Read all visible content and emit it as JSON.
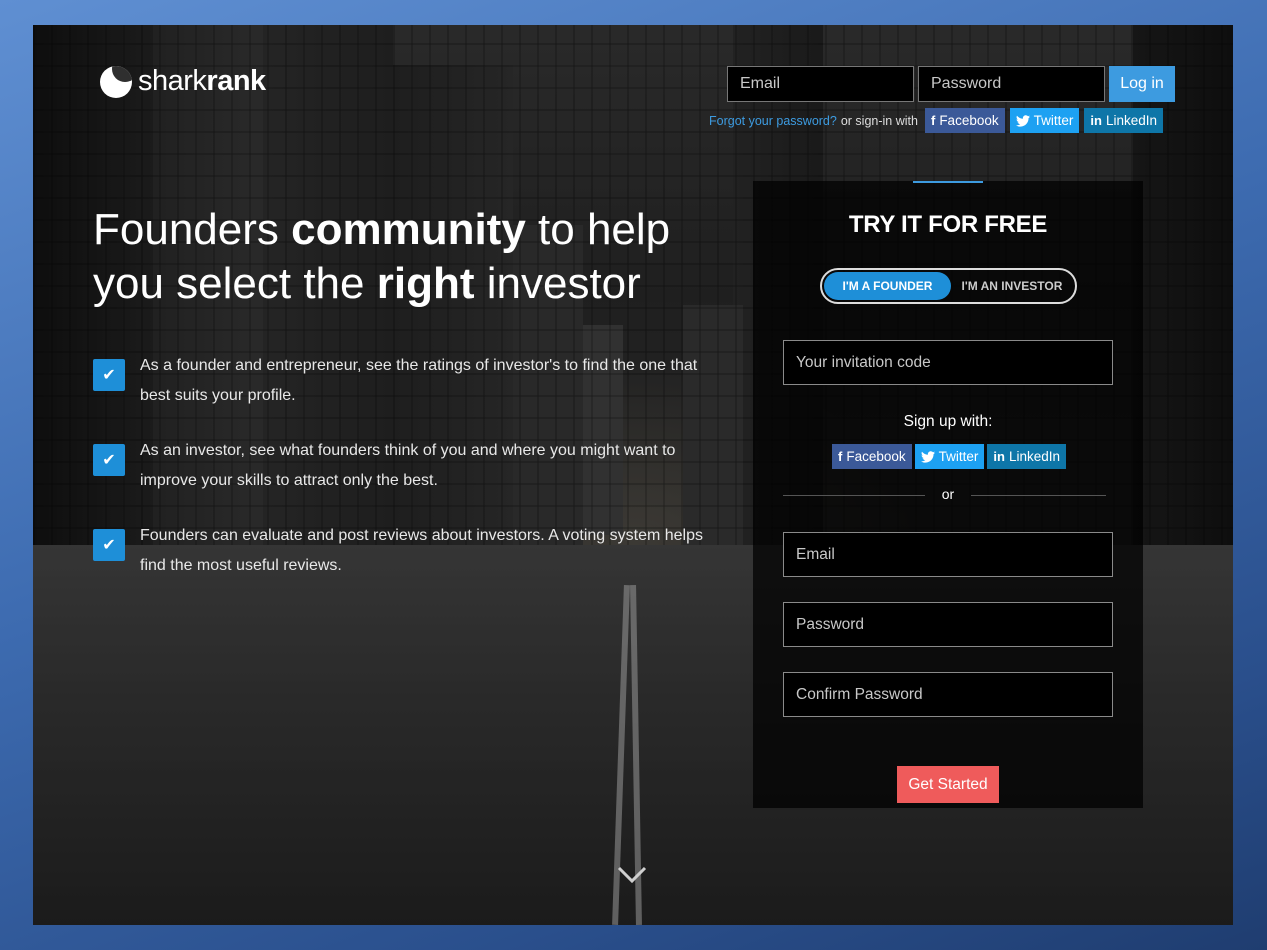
{
  "brand": {
    "name_light": "shark",
    "name_bold": "rank"
  },
  "header": {
    "email_placeholder": "Email",
    "password_placeholder": "Password",
    "login_label": "Log in",
    "forgot_label": "Forgot your password?",
    "signin_with_label": "or sign-in with",
    "social": {
      "facebook": "Facebook",
      "twitter": "Twitter",
      "linkedin": "LinkedIn"
    }
  },
  "hero": {
    "line1_a": "Founders ",
    "line1_bold": "community",
    "line1_b": " to help",
    "line2_a": "you select the ",
    "line2_bold": "right",
    "line2_b": " investor"
  },
  "features": [
    {
      "text": "As a founder and entrepreneur, see the ratings of investor's to find the one that best suits your profile."
    },
    {
      "text": "As an investor, see what founders think of you and where you might want to improve your skills to attract only the best."
    },
    {
      "text": "Founders can evaluate and post reviews about investors. A voting system helps find the most useful reviews."
    }
  ],
  "signup": {
    "title": "TRY IT FOR FREE",
    "role_founder": "I'M A FOUNDER",
    "role_investor": "I'M AN INVESTOR",
    "invitation_placeholder": "Your invitation code",
    "signup_with_label": "Sign up with:",
    "social": {
      "facebook": "Facebook",
      "twitter": "Twitter",
      "linkedin": "LinkedIn"
    },
    "or_label": "or",
    "email_placeholder": "Email",
    "password_placeholder": "Password",
    "confirm_placeholder": "Confirm Password",
    "cta_label": "Get Started"
  },
  "colors": {
    "accent_blue": "#1e8fd8",
    "login_blue": "#3d9be0",
    "cta_red": "#ef5b5b",
    "facebook": "#3b5998",
    "twitter": "#1da1f2",
    "linkedin": "#0e76a8"
  },
  "icons": [
    "logo-mark-icon",
    "facebook-icon",
    "twitter-icon",
    "linkedin-icon",
    "checkmark-icon",
    "chevron-down-icon"
  ]
}
